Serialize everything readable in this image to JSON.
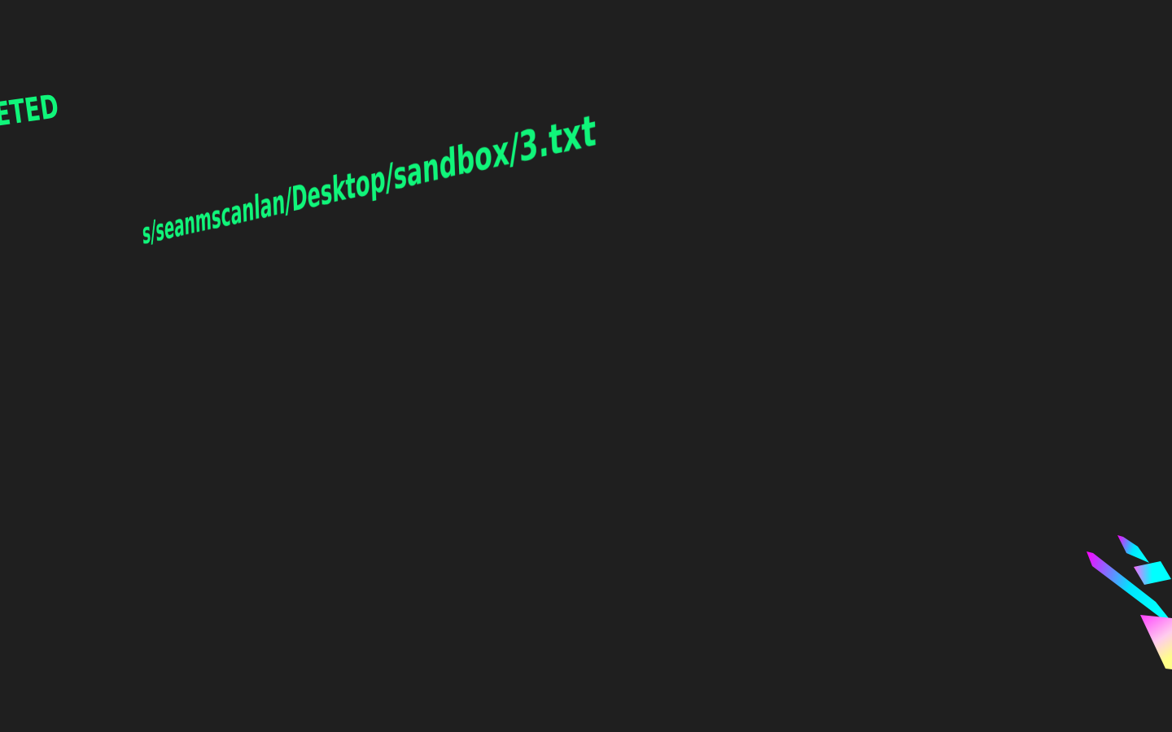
{
  "terminal": {
    "status_text": "LETED",
    "path_text": "s/seanmscanlan/Desktop/sandbox/3.txt",
    "text_color": "#10f57a"
  },
  "decoration": {
    "gradient_colors": [
      "#ff00ff",
      "#00ffff",
      "#ffff99"
    ]
  }
}
